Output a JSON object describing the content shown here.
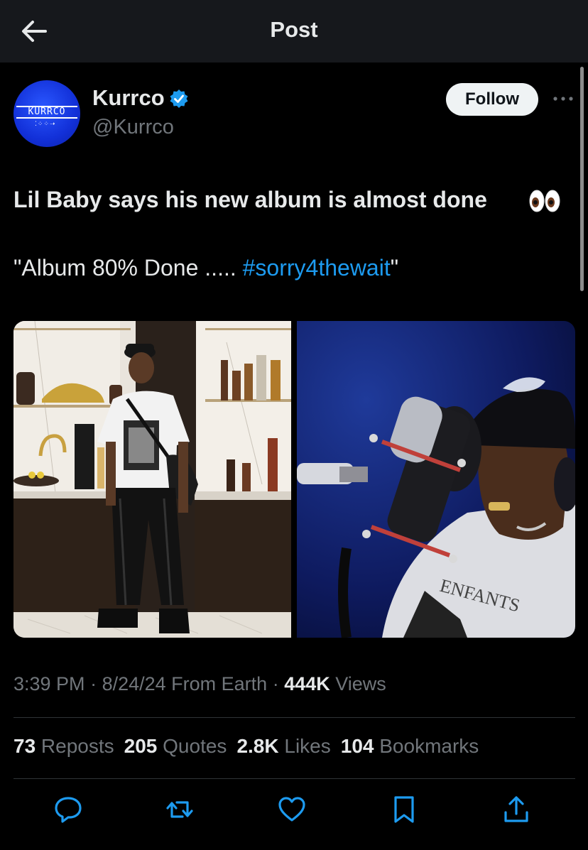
{
  "header": {
    "title": "Post",
    "back_icon": "arrow-left-icon"
  },
  "author": {
    "name": "Kurrco",
    "handle": "@Kurrco",
    "verified_icon": "verified-badge-icon",
    "avatar_logo": "KURRCO",
    "follow_label": "Follow",
    "more_icon": "more-icon"
  },
  "tweet": {
    "line1": "Lil Baby says his new album is almost done",
    "line1_emoji": "eyes-emoji",
    "line2_prefix": "\"Album 80% Done ..... ",
    "hashtag": "#sorry4thewait",
    "line2_suffix": "\""
  },
  "media": [
    {
      "description": "photo-man-in-kitchen"
    },
    {
      "description": "photo-man-recording-mic"
    }
  ],
  "meta": {
    "time": "3:39 PM",
    "sep1": " · ",
    "date": "8/24/24",
    "source": " From Earth",
    "sep2": " · ",
    "views_count": "444K",
    "views_label": " Views"
  },
  "stats": {
    "reposts_count": "73",
    "reposts_label": " Reposts",
    "quotes_count": "205",
    "quotes_label": " Quotes",
    "likes_count": "2.8K",
    "likes_label": " Likes",
    "bookmarks_count": "104",
    "bookmarks_label": " Bookmarks"
  },
  "actions": [
    "reply-icon",
    "repost-icon",
    "like-icon",
    "bookmark-icon",
    "share-icon"
  ],
  "colors": {
    "accent": "#1d9bf0",
    "background": "#000000",
    "secondary_text": "#71767b"
  }
}
